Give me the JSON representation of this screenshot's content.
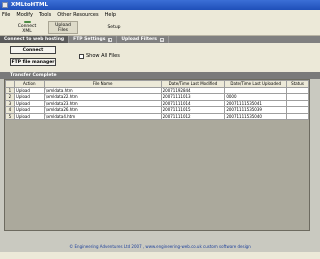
{
  "window": {
    "title": "XMLtoHTML"
  },
  "menu": [
    "File",
    "Modify",
    "Tools",
    "Other Resources",
    "Help"
  ],
  "toolbar": {
    "connect_label": "Connect\nXML",
    "upload_label": "Upload\nFiles",
    "setup_label": "Setup"
  },
  "tabs": [
    {
      "label": "Connect to web hosting",
      "active": true
    },
    {
      "label": "FTP Settings",
      "active": false
    },
    {
      "label": "Upload Filters",
      "active": false
    }
  ],
  "panel": {
    "connect_button": "Connect",
    "ftp_button": "FTP file manager",
    "show_all_label": "Show All Files",
    "show_all_checked": false
  },
  "status": {
    "label": "Transfer Complete"
  },
  "table": {
    "columns": [
      "",
      "Action",
      "File Name",
      "Date/Time Last Modified",
      "Date/Time Last Uploaded",
      "Status"
    ],
    "rows": [
      {
        "index": "1",
        "action": "Upload",
        "file": "\\xmldata.htm",
        "modified": "20071192844",
        "uploaded": "",
        "status": ""
      },
      {
        "index": "2",
        "action": "Upload",
        "file": "\\xmldata22.htm",
        "modified": "20071111013",
        "uploaded": "0000",
        "status": ""
      },
      {
        "index": "3",
        "action": "Upload",
        "file": "\\xmldata23.htm",
        "modified": "20071111014",
        "uploaded": "20071111535041",
        "status": ""
      },
      {
        "index": "4",
        "action": "Upload",
        "file": "\\xmldata26.htm",
        "modified": "20071111015",
        "uploaded": "20071111535039",
        "status": ""
      },
      {
        "index": "5",
        "action": "Upload",
        "file": "\\xmldata4.htm",
        "modified": "20071111012",
        "uploaded": "20071111535040",
        "status": ""
      }
    ]
  },
  "footer": {
    "text": "© Engineering Adventures Ltd 2007 , www.engineering-web.co.uk custom software design"
  }
}
